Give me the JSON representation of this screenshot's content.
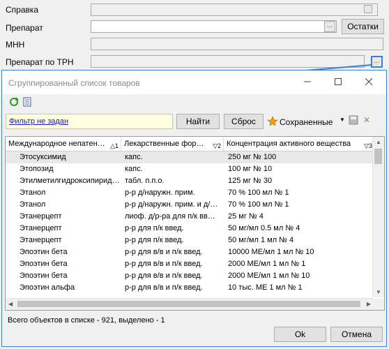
{
  "form": {
    "labels": {
      "spravka": "Справка",
      "preparat": "Препарат",
      "mnn": "МНН",
      "preparat_trn": "Препарат по ТРН"
    },
    "remains_button": "Остатки",
    "dots": "..."
  },
  "dialog": {
    "title": "Сгруппированный список товаров",
    "filter_text": "Фильтр не задан",
    "find_button": "Найти",
    "reset_button": "Сброс",
    "saved_label": "Сохраненные",
    "columns": [
      {
        "label": "Международное непатен…",
        "sort": "1"
      },
      {
        "label": "Лекарственные фор…",
        "sort": "2"
      },
      {
        "label": "Концентрация активного вещества",
        "sort": "3"
      }
    ],
    "rows": [
      {
        "mnn": "Этосуксимид",
        "form": "капс.",
        "conc": "250 мг № 100"
      },
      {
        "mnn": "Этопозид",
        "form": "капс.",
        "conc": "100 мг № 10"
      },
      {
        "mnn": "Этилметилгидроксипирид…",
        "form": "табл. п.п.о.",
        "conc": "125 мг № 30"
      },
      {
        "mnn": "Этанол",
        "form": "р-р д/наружн. прим.",
        "conc": "70 % 100 мл № 1"
      },
      {
        "mnn": "Этанол",
        "form": "р-р д/наружн. прим. и д/…",
        "conc": "70 % 100 мл № 1"
      },
      {
        "mnn": "Этанерцепт",
        "form": "лиоф. д/р-ра для п/к вв…",
        "conc": "25 мг № 4"
      },
      {
        "mnn": "Этанерцепт",
        "form": "р-р для п/к введ.",
        "conc": "50 мг/мл 0.5 мл № 4"
      },
      {
        "mnn": "Этанерцепт",
        "form": "р-р для п/к введ.",
        "conc": "50 мг/мл 1 мл № 4"
      },
      {
        "mnn": "Эпоэтин бета",
        "form": "р-р для в/в и п/к введ.",
        "conc": "10000 МЕ/мл 1 мл № 10"
      },
      {
        "mnn": "Эпоэтин бета",
        "form": "р-р для в/в и п/к введ.",
        "conc": "2000 МЕ/мл 1 мл № 1"
      },
      {
        "mnn": "Эпоэтин бета",
        "form": "р-р для в/в и п/к введ.",
        "conc": "2000 МЕ/мл 1 мл № 10"
      },
      {
        "mnn": "Эпоэтин альфа",
        "form": "р-р для в/в и п/к введ.",
        "conc": "10 тыс. МЕ 1 мл № 1"
      }
    ],
    "status": "Всего объектов в списке - 921, выделено - 1",
    "ok_button": "Ok",
    "cancel_button": "Отмена"
  },
  "icons": [
    "refresh-icon",
    "settings-icon",
    "star-icon",
    "dropdown-arrow-icon",
    "save-icon",
    "close-icon",
    "minimize-icon",
    "maximize-icon"
  ],
  "colors": {
    "accent": "#3d7fd6",
    "filter_bg": "#ffffe1",
    "link": "#1a1aa0"
  }
}
